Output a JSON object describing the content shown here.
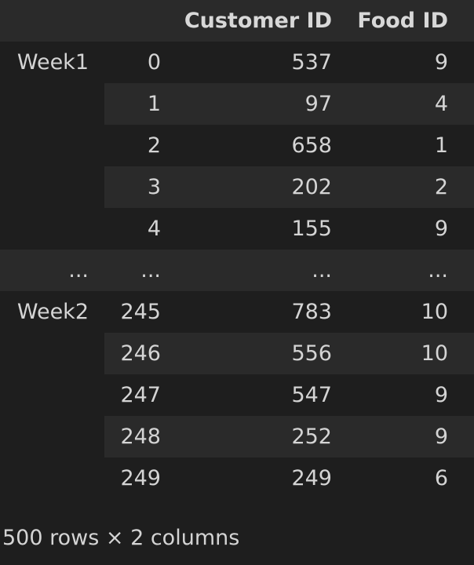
{
  "table": {
    "columns": [
      "Customer ID",
      "Food ID"
    ],
    "rows": [
      {
        "group": "Week1",
        "index": "0",
        "customer_id": "537",
        "food_id": "9"
      },
      {
        "group": "",
        "index": "1",
        "customer_id": "97",
        "food_id": "4"
      },
      {
        "group": "",
        "index": "2",
        "customer_id": "658",
        "food_id": "1"
      },
      {
        "group": "",
        "index": "3",
        "customer_id": "202",
        "food_id": "2"
      },
      {
        "group": "",
        "index": "4",
        "customer_id": "155",
        "food_id": "9"
      },
      {
        "group": "...",
        "index": "...",
        "customer_id": "...",
        "food_id": "..."
      },
      {
        "group": "Week2",
        "index": "245",
        "customer_id": "783",
        "food_id": "10"
      },
      {
        "group": "",
        "index": "246",
        "customer_id": "556",
        "food_id": "10"
      },
      {
        "group": "",
        "index": "247",
        "customer_id": "547",
        "food_id": "9"
      },
      {
        "group": "",
        "index": "248",
        "customer_id": "252",
        "food_id": "9"
      },
      {
        "group": "",
        "index": "249",
        "customer_id": "249",
        "food_id": "6"
      }
    ]
  },
  "footer": "500 rows × 2 columns"
}
